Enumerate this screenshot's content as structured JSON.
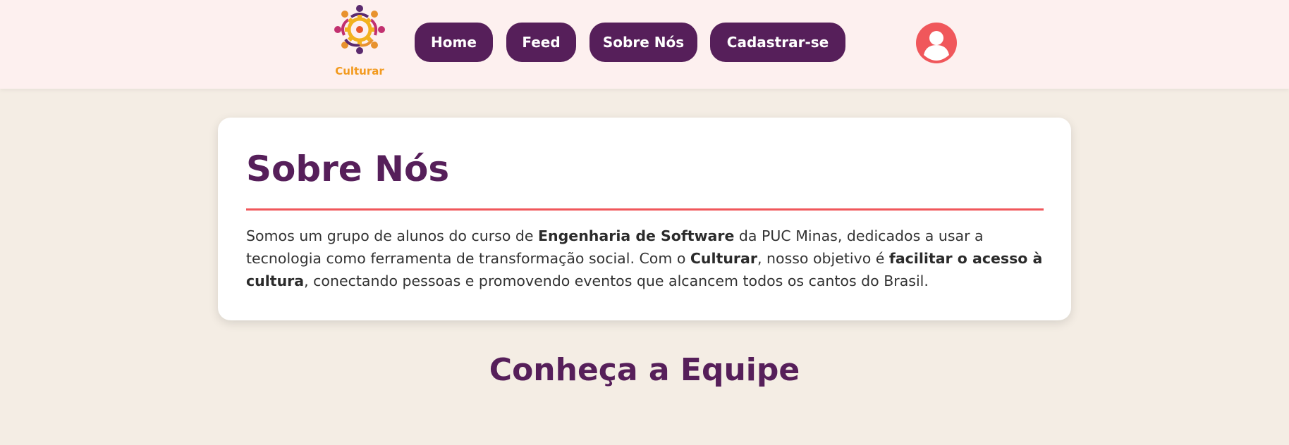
{
  "header": {
    "logo_text": "Culturar",
    "nav": [
      {
        "label": "Home"
      },
      {
        "label": "Feed"
      },
      {
        "label": "Sobre Nós"
      },
      {
        "label": "Cadastrar-se"
      }
    ],
    "profile_icon": "user-profile-icon"
  },
  "about": {
    "title": "Sobre Nós",
    "text": {
      "p1": "Somos um grupo de alunos do curso de ",
      "b1": "Engenharia de Software",
      "p2": " da PUC Minas, dedicados a usar a tecnologia como ferramenta de transformação social. Com o ",
      "b2": "Culturar",
      "p3": ", nosso objetivo é ",
      "b3": "facilitar o acesso à cultura",
      "p4": ", conectando pessoas e promovendo eventos que alcancem todos os cantos do Brasil."
    }
  },
  "team": {
    "title": "Conheça a Equipe"
  },
  "colors": {
    "primary": "#561f5a",
    "accent": "#f0575b",
    "logo_orange": "#f29a1f",
    "header_bg": "#fdf0ef",
    "page_bg": "#f4ede4"
  }
}
